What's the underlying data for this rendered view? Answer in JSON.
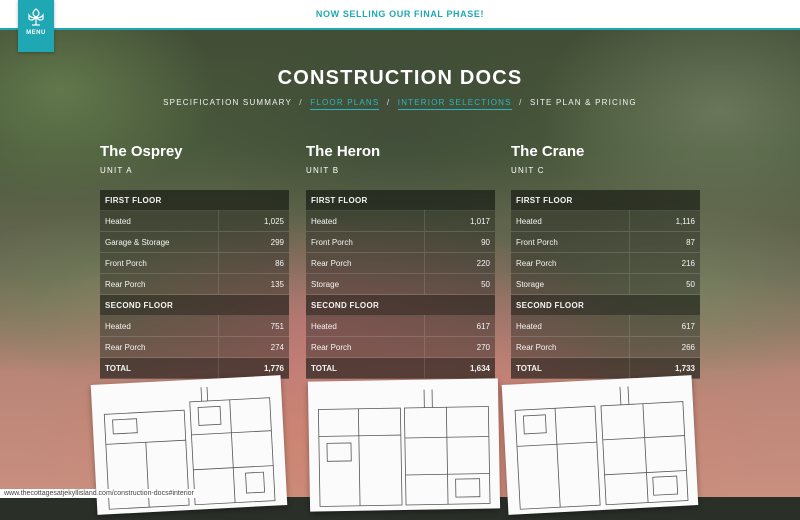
{
  "banner": {
    "text": "NOW SELLING OUR FINAL PHASE!"
  },
  "menu": {
    "label": "MENU",
    "icon": "tree-emblem-icon"
  },
  "page": {
    "title": "CONSTRUCTION DOCS"
  },
  "subnav": {
    "items": [
      {
        "label": "SPECIFICATION SUMMARY",
        "active": false
      },
      {
        "label": "FLOOR PLANS",
        "active": true
      },
      {
        "label": "INTERIOR SELECTIONS",
        "active": true
      },
      {
        "label": "SITE PLAN & PRICING",
        "active": false
      }
    ],
    "separator": "/"
  },
  "units": [
    {
      "name": "The Osprey",
      "sub": "UNIT A",
      "first_floor_label": "FIRST FLOOR",
      "first_floor": [
        {
          "label": "Heated",
          "value": "1,025"
        },
        {
          "label": "Garage & Storage",
          "value": "299"
        },
        {
          "label": "Front Porch",
          "value": "86"
        },
        {
          "label": "Rear Porch",
          "value": "135"
        }
      ],
      "second_floor_label": "SECOND FLOOR",
      "second_floor": [
        {
          "label": "Heated",
          "value": "751"
        },
        {
          "label": "Rear Porch",
          "value": "274"
        }
      ],
      "total_label": "TOTAL",
      "total": "1,776"
    },
    {
      "name": "The Heron",
      "sub": "UNIT B",
      "first_floor_label": "FIRST FLOOR",
      "first_floor": [
        {
          "label": "Heated",
          "value": "1,017"
        },
        {
          "label": "Front Porch",
          "value": "90"
        },
        {
          "label": "Rear Porch",
          "value": "220"
        },
        {
          "label": "Storage",
          "value": "50"
        }
      ],
      "second_floor_label": "SECOND FLOOR",
      "second_floor": [
        {
          "label": "Heated",
          "value": "617"
        },
        {
          "label": "Rear Porch",
          "value": "270"
        }
      ],
      "total_label": "TOTAL",
      "total": "1,634"
    },
    {
      "name": "The Crane",
      "sub": "UNIT C",
      "first_floor_label": "FIRST FLOOR",
      "first_floor": [
        {
          "label": "Heated",
          "value": "1,116"
        },
        {
          "label": "Front Porch",
          "value": "87"
        },
        {
          "label": "Rear Porch",
          "value": "216"
        },
        {
          "label": "Storage",
          "value": "50"
        }
      ],
      "second_floor_label": "SECOND FLOOR",
      "second_floor": [
        {
          "label": "Heated",
          "value": "617"
        },
        {
          "label": "Rear Porch",
          "value": "266"
        }
      ],
      "total_label": "TOTAL",
      "total": "1,733"
    }
  ],
  "status_url": "www.thecottagesatjekyllisland.com/construction-docs#interior",
  "colors": {
    "accent": "#1fa8b4",
    "banner_bg": "#ffffff"
  }
}
